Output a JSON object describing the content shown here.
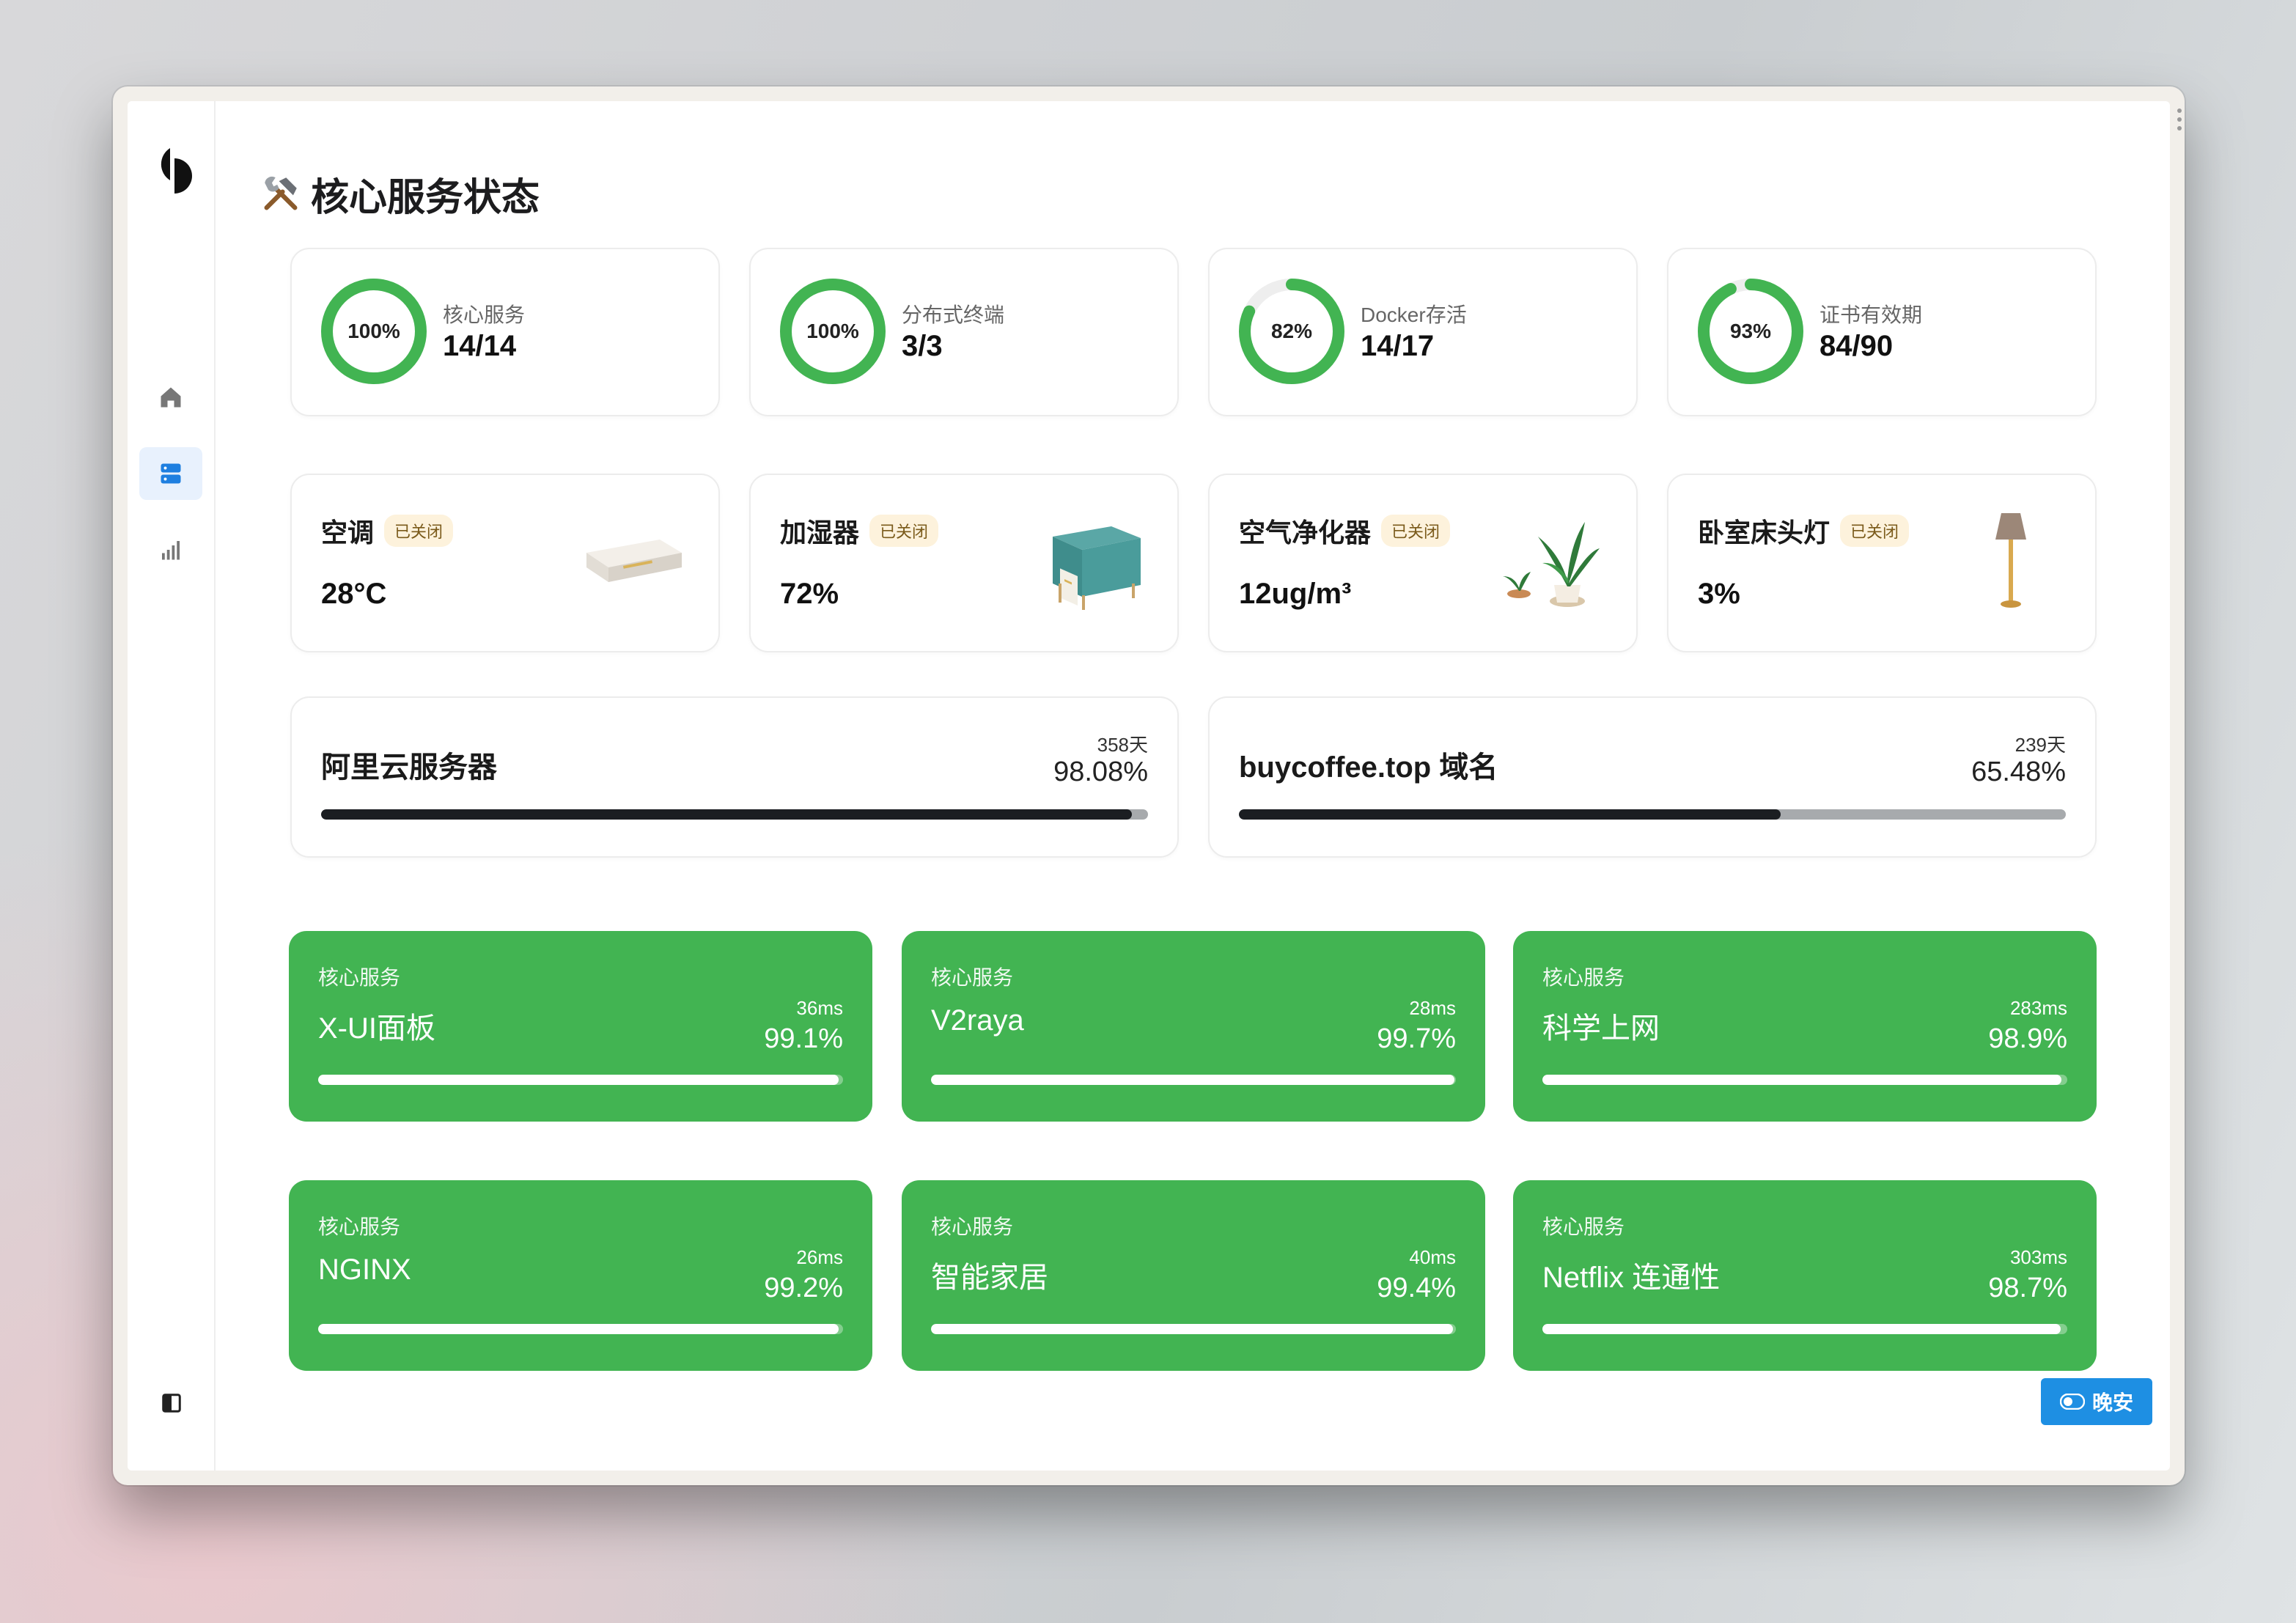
{
  "page": {
    "title": "核心服务状态",
    "title_icon": "tools-icon"
  },
  "sidebar": {
    "items": [
      {
        "icon": "home-icon",
        "active": false
      },
      {
        "icon": "server-icon",
        "active": true
      },
      {
        "icon": "bar-chart-icon",
        "active": false
      }
    ],
    "toggle_icon": "sidebar-toggle-icon"
  },
  "stats": [
    {
      "label": "核心服务",
      "value": "14/14",
      "percent_text": "100%",
      "percent": 100
    },
    {
      "label": "分布式终端",
      "value": "3/3",
      "percent_text": "100%",
      "percent": 100
    },
    {
      "label": "Docker存活",
      "value": "14/17",
      "percent_text": "82%",
      "percent": 82
    },
    {
      "label": "证书有效期",
      "value": "84/90",
      "percent_text": "93%",
      "percent": 93
    }
  ],
  "devices": [
    {
      "name": "空调",
      "status": "已关闭",
      "value": "28°C",
      "image": "air-conditioner-image"
    },
    {
      "name": "加湿器",
      "status": "已关闭",
      "value": "72%",
      "image": "humidifier-image"
    },
    {
      "name": "空气净化器",
      "status": "已关闭",
      "value": "12ug/m³",
      "image": "plant-image"
    },
    {
      "name": "卧室床头灯",
      "status": "已关闭",
      "value": "3%",
      "image": "floor-lamp-image"
    }
  ],
  "expiry": [
    {
      "title": "阿里云服务器",
      "days": "358天",
      "percent_text": "98.08%",
      "percent": 98.08
    },
    {
      "title": "buycoffee.top 域名",
      "days": "239天",
      "percent_text": "65.48%",
      "percent": 65.48
    }
  ],
  "services": [
    {
      "category": "核心服务",
      "name": "X-UI面板",
      "latency": "36ms",
      "uptime": "99.1%",
      "percent": 99.1
    },
    {
      "category": "核心服务",
      "name": "V2raya",
      "latency": "28ms",
      "uptime": "99.7%",
      "percent": 99.7
    },
    {
      "category": "核心服务",
      "name": "科学上网",
      "latency": "283ms",
      "uptime": "98.9%",
      "percent": 98.9
    },
    {
      "category": "核心服务",
      "name": "NGINX",
      "latency": "26ms",
      "uptime": "99.2%",
      "percent": 99.2
    },
    {
      "category": "核心服务",
      "name": "智能家居",
      "latency": "40ms",
      "uptime": "99.4%",
      "percent": 99.4
    },
    {
      "category": "核心服务",
      "name": "Netflix 连通性",
      "latency": "303ms",
      "uptime": "98.7%",
      "percent": 98.7
    }
  ],
  "theme_button": {
    "label": "晚安",
    "icon": "toggle-icon"
  },
  "colors": {
    "green": "#42b452",
    "blue": "#1e8fe3",
    "dark": "#1b1e22"
  }
}
